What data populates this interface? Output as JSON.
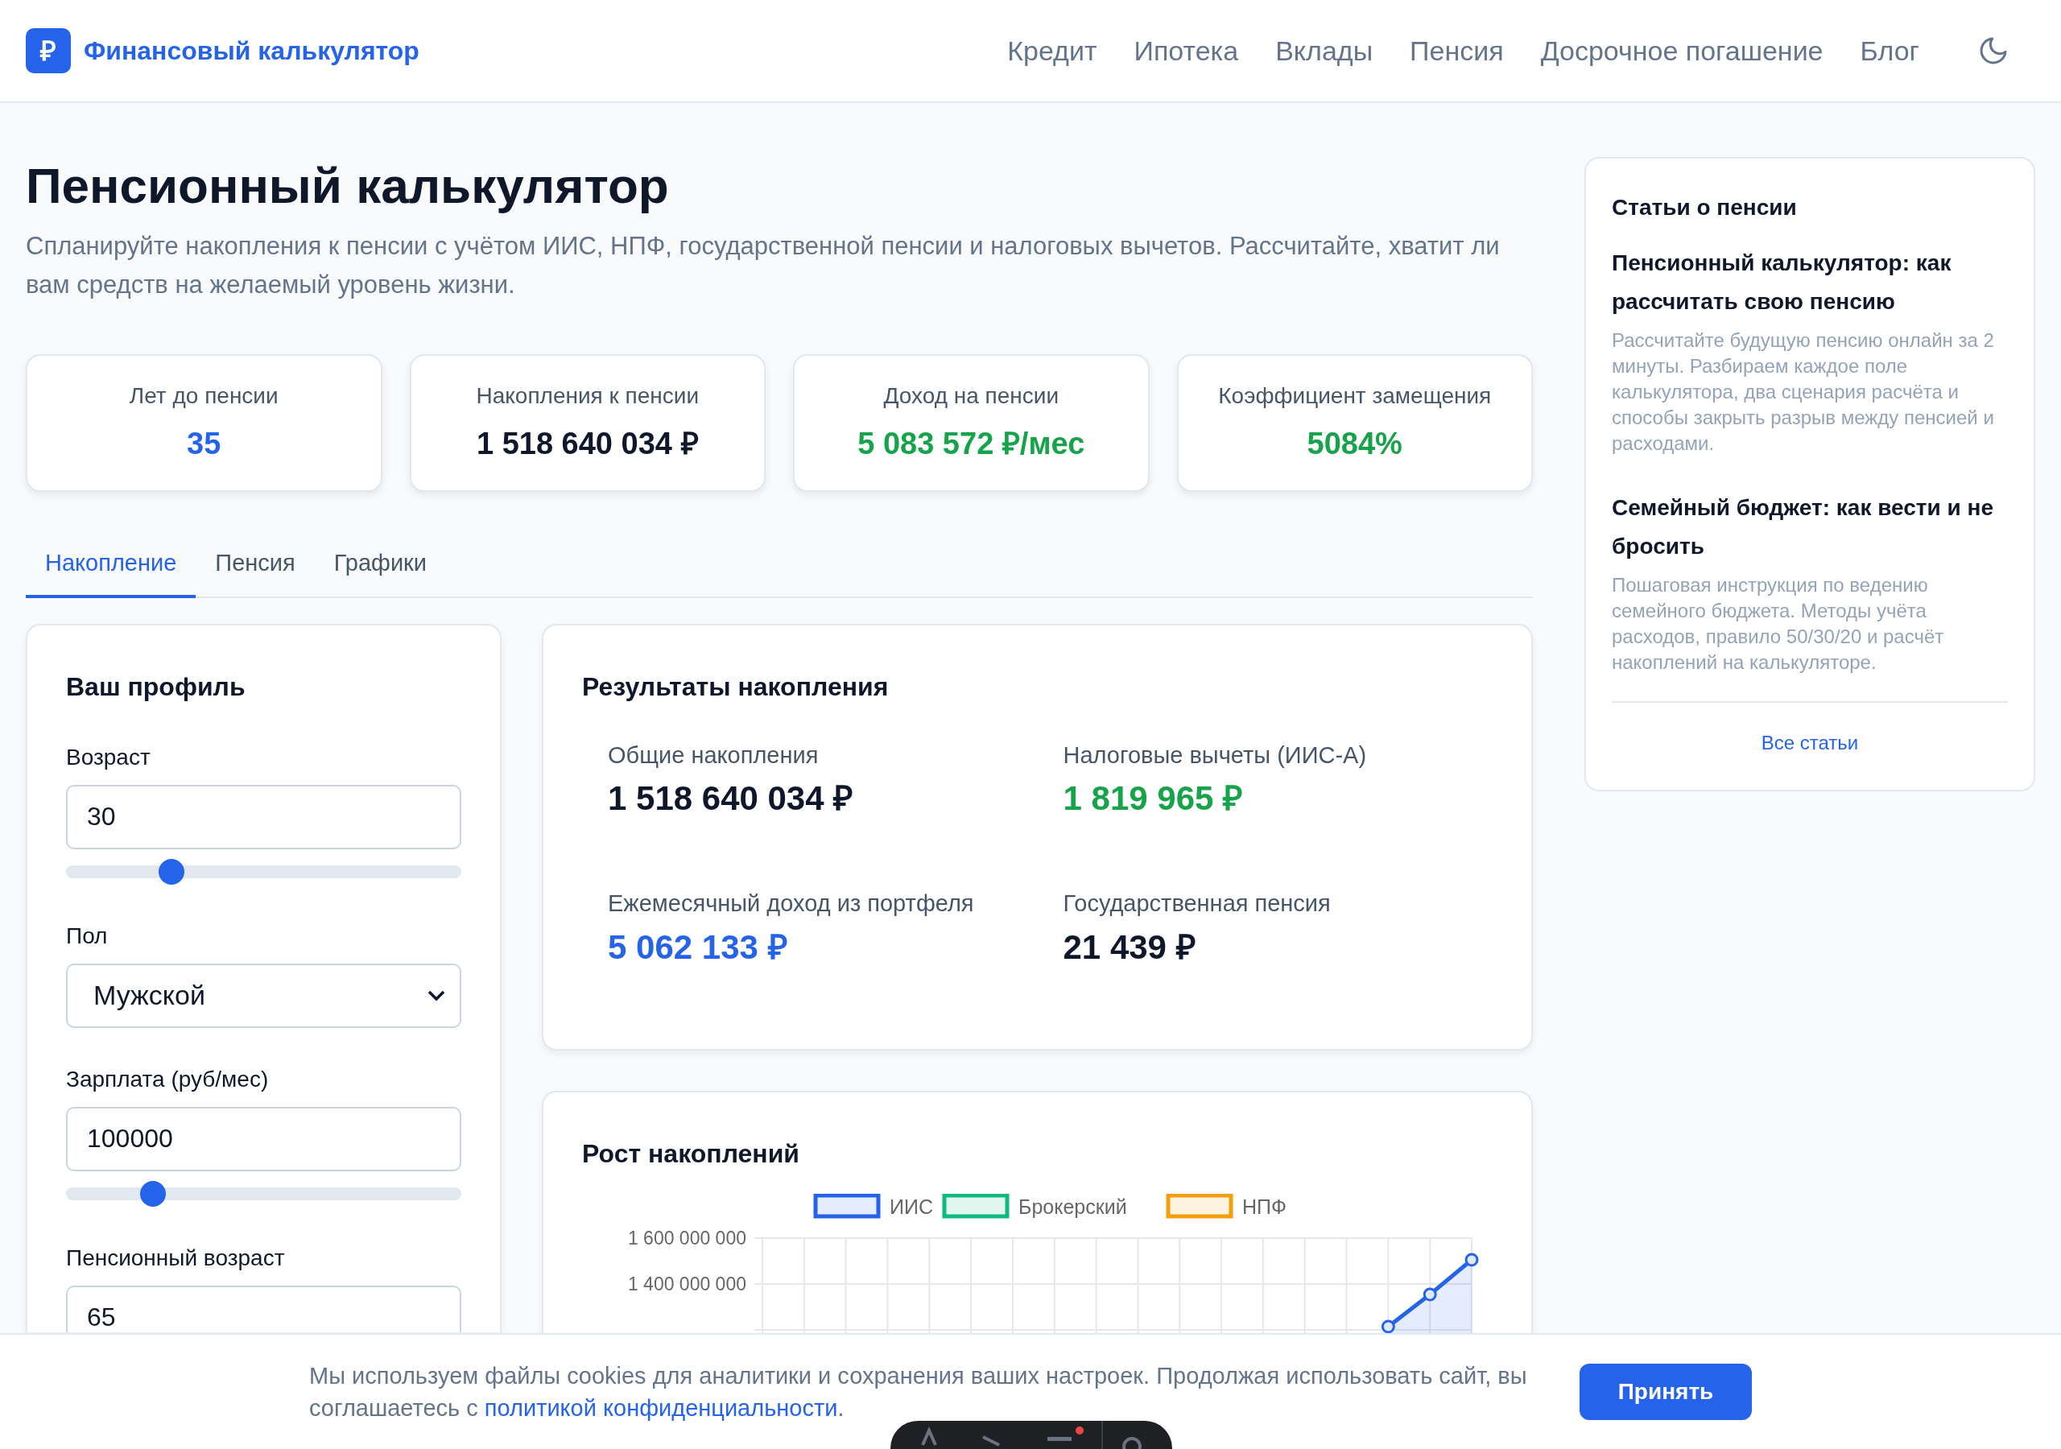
{
  "header": {
    "logo": "₽",
    "brand": "Финансовый калькулятор",
    "nav": [
      "Кредит",
      "Ипотека",
      "Вклады",
      "Пенсия",
      "Досрочное погашение",
      "Блог"
    ]
  },
  "page": {
    "title": "Пенсионный калькулятор",
    "subtitle": "Спланируйте накопления к пенсии с учётом ИИС, НПФ, государственной пенсии и налоговых вычетов. Рассчитайте, хватит ли вам средств на желаемый уровень жизни."
  },
  "stats": [
    {
      "label": "Лет до пенсии",
      "value": "35",
      "color": "#2563eb"
    },
    {
      "label": "Накопления к пенсии",
      "value": "1 518 640 034 ₽",
      "color": "#0f172a"
    },
    {
      "label": "Доход на пенсии",
      "value": "5 083 572 ₽/мес",
      "color": "#16a34a"
    },
    {
      "label": "Коэффициент замещения",
      "value": "5084%",
      "color": "#16a34a"
    }
  ],
  "tabs": [
    {
      "label": "Накопление",
      "selected": true
    },
    {
      "label": "Пенсия",
      "selected": false
    },
    {
      "label": "Графики",
      "selected": false
    }
  ],
  "profile": {
    "title": "Ваш профиль",
    "fields": [
      {
        "kind": "slider",
        "label": "Возраст",
        "value": "30",
        "level": 0.25
      },
      {
        "kind": "select",
        "label": "Пол",
        "value": "Мужской"
      },
      {
        "kind": "slider",
        "label": "Зарплата (руб/мес)",
        "value": "100000",
        "level": 0.2
      },
      {
        "kind": "input",
        "label": "Пенсионный возраст",
        "value": "65"
      }
    ]
  },
  "results": {
    "title": "Результаты накопления",
    "items": [
      {
        "label": "Общие накопления",
        "value": "1 518 640 034 ₽",
        "color": "#0f172a"
      },
      {
        "label": "Налоговые вычеты (ИИС-А)",
        "value": "1 819 965 ₽",
        "color": "#16a34a"
      },
      {
        "label": "Ежемесячный доход из портфеля",
        "value": "5 062 133 ₽",
        "color": "#2563eb"
      },
      {
        "label": "Государственная пенсия",
        "value": "21 439 ₽",
        "color": "#0f172a"
      }
    ]
  },
  "growth": {
    "title": "Рост накоплений",
    "legend": [
      {
        "name": "ИИС",
        "color": "#2563eb"
      },
      {
        "name": "Брокерский",
        "color": "#10b981"
      },
      {
        "name": "НПФ",
        "color": "#f59e0b"
      }
    ],
    "axis_labels": [
      "1 600 000 000",
      "1 400 000 000"
    ]
  },
  "articles": {
    "title": "Статьи о пенсии",
    "items": [
      {
        "title": "Пенсионный калькулятор: как рассчитать свою пенсию",
        "summary": "Рассчитайте будущую пенсию онлайн за 2 минуты. Разбираем каждое поле калькулятора, два сценария расчёта и способы закрыть разрыв между пенсией и расходами."
      },
      {
        "title": "Семейный бюджет: как вести и не бросить",
        "summary": "Пошаговая инструкция по ведению семейного бюджета. Методы учёта расходов, правило 50/30/20 и расчёт накоплений на калькуляторе."
      }
    ],
    "link": "Все статьи"
  },
  "cookie": {
    "text": "Мы используем файлы cookies для аналитики и сохранения ваших настроек. Продолжая использовать сайт, вы соглашаетесь с ",
    "link": "политикой конфиденциальности",
    "end": ".",
    "button": "Принять"
  }
}
